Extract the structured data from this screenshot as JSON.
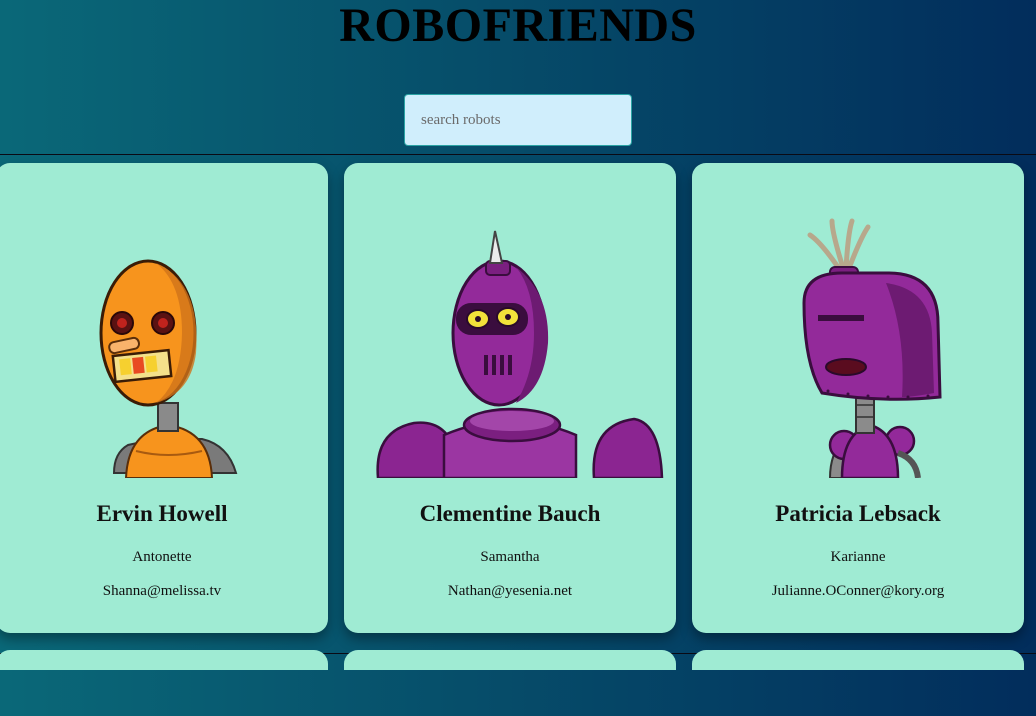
{
  "app": {
    "title": "ROBOFRIENDS"
  },
  "search": {
    "placeholder": "search robots",
    "value": ""
  },
  "colors": {
    "card_background": "#9febd3",
    "search_background": "#d0eefc",
    "background_left": "#0a6878",
    "background_right": "#022d5c"
  },
  "robots": [
    {
      "name": "Ervin Howell",
      "username": "Antonette",
      "email": "Shanna@melissa.tv",
      "avatar": "orange-robot-image"
    },
    {
      "name": "Clementine Bauch",
      "username": "Samantha",
      "email": "Nathan@yesenia.net",
      "avatar": "purple-horned-robot-image"
    },
    {
      "name": "Patricia Lebsack",
      "username": "Karianne",
      "email": "Julianne.OConner@kory.org",
      "avatar": "purple-helmet-robot-image"
    }
  ]
}
